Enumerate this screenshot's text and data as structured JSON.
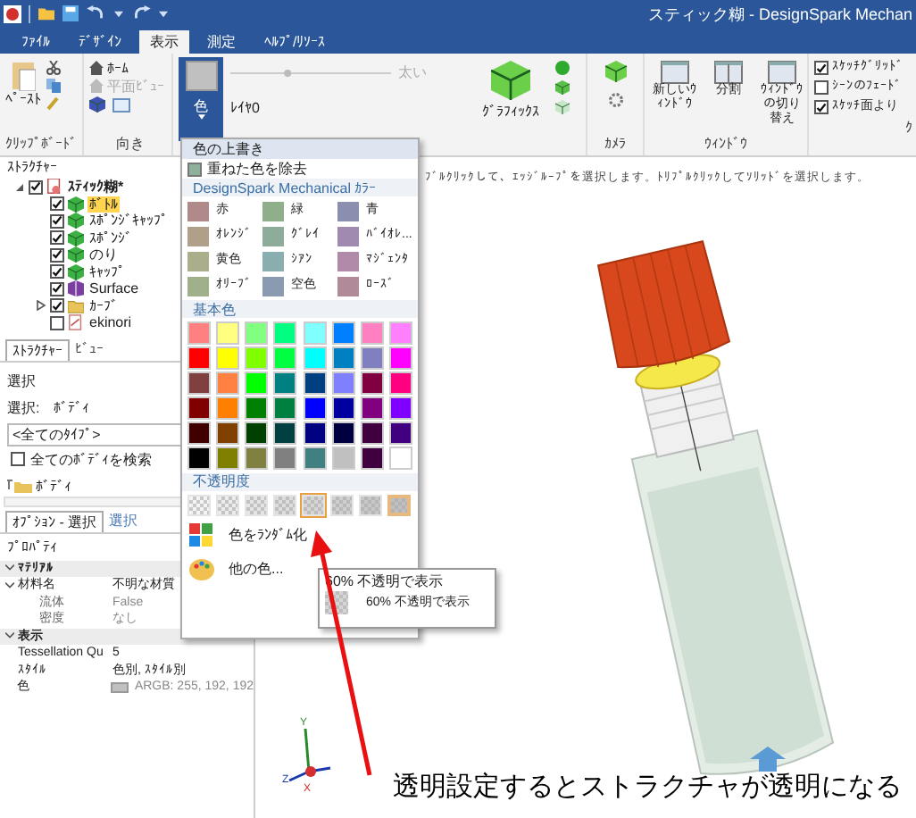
{
  "title_bar": {
    "title": "スティック糊 - DesignSpark  Mechan"
  },
  "menu_tabs": [
    {
      "label": "ﾌｧｲﾙ",
      "selected": false
    },
    {
      "label": "ﾃﾞｻﾞｲﾝ",
      "selected": false
    },
    {
      "label": "表示",
      "selected": true
    },
    {
      "label": "測定",
      "selected": false
    },
    {
      "label": "ﾍﾙﾌﾟ/ﾘｿｰｽ",
      "selected": false
    }
  ],
  "ribbon": {
    "clipboard": {
      "paste": "ﾍﾟｰｽﾄ",
      "label": "ｸﾘｯﾌﾟﾎﾞｰﾄﾞ"
    },
    "orientation": {
      "items": [
        {
          "label": "ﾎｰﾑ",
          "disabled": false
        },
        {
          "label": "平面ﾋﾞｭｰ",
          "disabled": true
        }
      ],
      "label": "向き"
    },
    "color_button": {
      "label": "色",
      "selected": true
    },
    "line_weight_slider": {
      "level": 0.35
    },
    "line_weight": "太い",
    "layer": "ﾚｲﾔ0",
    "graphics": "ｸﾞﾗﾌｨｯｸｽ",
    "camera": "ｶﾒﾗ",
    "window": {
      "items": [
        "新しいｳｨﾝﾄﾞｳ",
        "分割",
        "ｳｨﾝﾄﾞｳの切り替え"
      ],
      "label": "ｳｨﾝﾄﾞｳ"
    },
    "checkboxes": [
      {
        "label": "ｽｹｯﾁｸﾞﾘｯﾄﾞ",
        "checked": true
      },
      {
        "label": "ｼｰﾝのﾌｪｰﾄﾞ",
        "checked": false
      },
      {
        "label": "ｽｹｯﾁ面より",
        "checked": true
      }
    ],
    "display_label": "ｸ"
  },
  "structure": {
    "title": "ｽﾄﾗｸﾁｬｰ",
    "tree": [
      {
        "label": "ｽﾃｨｯｸ糊*",
        "kind": "assembly",
        "checked": true,
        "expanded": true,
        "selected": false,
        "children": [
          {
            "label": "ﾎﾞﾄﾙ",
            "kind": "body",
            "checked": true,
            "selected": true
          },
          {
            "label": "ｽﾎﾟﾝｼﾞｷｬｯﾌﾟ",
            "kind": "body",
            "checked": true,
            "selected": false
          },
          {
            "label": "ｽﾎﾟﾝｼﾞ",
            "kind": "body",
            "checked": true,
            "selected": false
          },
          {
            "label": "のり",
            "kind": "body",
            "checked": true,
            "selected": false
          },
          {
            "label": "ｷｬｯﾌﾟ",
            "kind": "body",
            "checked": true,
            "selected": false
          },
          {
            "label": "Surface",
            "kind": "surface",
            "checked": true,
            "selected": false
          },
          {
            "label": "ｶｰﾌﾞ",
            "kind": "folder",
            "checked": true,
            "expanded": false,
            "selected": false
          },
          {
            "label": "ekinori",
            "kind": "sketch",
            "checked": false,
            "selected": false
          }
        ]
      }
    ],
    "tabs": [
      {
        "label": "ｽﾄﾗｸﾁｬｰ",
        "selected": true
      },
      {
        "label": "ﾋﾞｭｰ",
        "selected": false
      }
    ]
  },
  "selection": {
    "title": "選択",
    "label": "選択:",
    "value": "ﾎﾞﾃﾞｨ",
    "filter": "<全てのﾀｲﾌﾟ>",
    "search_all": {
      "label": "全てのﾎﾞﾃﾞｨを検索",
      "checked": false
    },
    "result": "ﾎﾞﾃﾞｨ",
    "tabs": [
      {
        "label": "ｵﾌﾟｼｮﾝ - 選択",
        "selected": true
      },
      {
        "label": "選択",
        "selected": false
      }
    ]
  },
  "properties": {
    "title": "ﾌﾟﾛﾊﾟﾃｨ",
    "rows": [
      {
        "kind": "group",
        "label": "ﾏﾃﾘｱﾙ",
        "expanded": true
      },
      {
        "kind": "group-prop",
        "label": "材料名",
        "value": "不明な材質",
        "expanded": true
      },
      {
        "kind": "sub",
        "label": "流体",
        "value": "False"
      },
      {
        "kind": "sub",
        "label": "密度",
        "value": "なし"
      },
      {
        "kind": "group",
        "label": "表示",
        "expanded": true
      },
      {
        "kind": "prop",
        "label": "Tessellation Qu",
        "value": "5"
      },
      {
        "kind": "prop",
        "label": "ｽﾀｲﾙ",
        "value": "色別, ｽﾀｲﾙ別"
      },
      {
        "kind": "color",
        "label": "色",
        "value": "ARGB: 255, 192, 192",
        "color": "#c0c0c0"
      }
    ]
  },
  "viewport": {
    "hint": "ﾌﾞﾙｸﾘｯｸして、ｴｯｼﾞﾙｰﾌﾟを選択します。ﾄﾘﾌﾟﾙｸﾘｯｸしてｿﾘｯﾄﾞを選択します。",
    "axis_labels": [
      "Y",
      "Z",
      "X"
    ]
  },
  "color_menu": {
    "title": "色の上書き",
    "remove": "重ねた色を除去",
    "ds_title": "DesignSpark Mechanical ｶﾗｰ",
    "ds_colors": [
      {
        "label": "赤",
        "color": "#b08a8a"
      },
      {
        "label": "緑",
        "color": "#8fae8a"
      },
      {
        "label": "青",
        "color": "#8a8fb0"
      },
      {
        "label": "ｵﾚﾝｼﾞ",
        "color": "#b0a08a"
      },
      {
        "label": "ｸﾞﾚｲ",
        "color": "#8eac9a"
      },
      {
        "label": "ﾊﾞｲｵﾚ...",
        "color": "#a08ab0"
      },
      {
        "label": "黄色",
        "color": "#aaae8a"
      },
      {
        "label": "ｼｱﾝ",
        "color": "#8aaeb0"
      },
      {
        "label": "ﾏｼﾞｪﾝﾀ",
        "color": "#b08aa8"
      },
      {
        "label": "ｵﾘｰﾌﾞ",
        "color": "#a0b08a"
      },
      {
        "label": "空色",
        "color": "#8a9ab0"
      },
      {
        "label": "ﾛｰｽﾞ",
        "color": "#b08a98"
      }
    ],
    "basic_title": "基本色",
    "basic_colors": [
      {
        "color": "#ff8080"
      },
      {
        "color": "#ffff80"
      },
      {
        "color": "#80ff80"
      },
      {
        "color": "#00ff80"
      },
      {
        "color": "#80ffff"
      },
      {
        "color": "#0080ff"
      },
      {
        "color": "#ff80c0"
      },
      {
        "color": "#ff80ff"
      },
      {
        "color": "#ff0000"
      },
      {
        "color": "#ffff00"
      },
      {
        "color": "#80ff00"
      },
      {
        "color": "#00ff40"
      },
      {
        "color": "#00ffff"
      },
      {
        "color": "#0080c0"
      },
      {
        "color": "#8080c0"
      },
      {
        "color": "#ff00ff"
      },
      {
        "color": "#804040"
      },
      {
        "color": "#ff8040"
      },
      {
        "color": "#00ff00"
      },
      {
        "color": "#008080"
      },
      {
        "color": "#004080"
      },
      {
        "color": "#8080ff"
      },
      {
        "color": "#800040"
      },
      {
        "color": "#ff0080"
      },
      {
        "color": "#800000"
      },
      {
        "color": "#ff8000"
      },
      {
        "color": "#008000"
      },
      {
        "color": "#008040"
      },
      {
        "color": "#0000ff"
      },
      {
        "color": "#0000a0"
      },
      {
        "color": "#800080"
      },
      {
        "color": "#8000ff"
      },
      {
        "color": "#400000"
      },
      {
        "color": "#804000"
      },
      {
        "color": "#004000"
      },
      {
        "color": "#004040"
      },
      {
        "color": "#000080"
      },
      {
        "color": "#000040"
      },
      {
        "color": "#400040"
      },
      {
        "color": "#400080"
      },
      {
        "color": "#000000"
      },
      {
        "color": "#808000"
      },
      {
        "color": "#808040"
      },
      {
        "color": "#808080"
      },
      {
        "color": "#408080"
      },
      {
        "color": "#c0c0c0"
      },
      {
        "color": "#400040"
      },
      {
        "color": "#ffffff"
      }
    ],
    "opacity_title": "不透明度",
    "opacity": [
      {
        "hovered": false,
        "selected": false
      },
      {
        "hovered": false,
        "selected": false
      },
      {
        "hovered": false,
        "selected": false
      },
      {
        "hovered": false,
        "selected": false
      },
      {
        "hovered": true,
        "selected": false
      },
      {
        "hovered": false,
        "selected": false
      },
      {
        "hovered": false,
        "selected": false
      },
      {
        "hovered": false,
        "selected": true
      }
    ],
    "randomize": "色をﾗﾝﾀﾞﾑ化",
    "more": "他の色..."
  },
  "tooltip": {
    "title": "60% 不透明で表示",
    "text": "60% 不透明で表示"
  },
  "annotation": {
    "caption": "透明設定するとストラクチャが透明になる"
  }
}
